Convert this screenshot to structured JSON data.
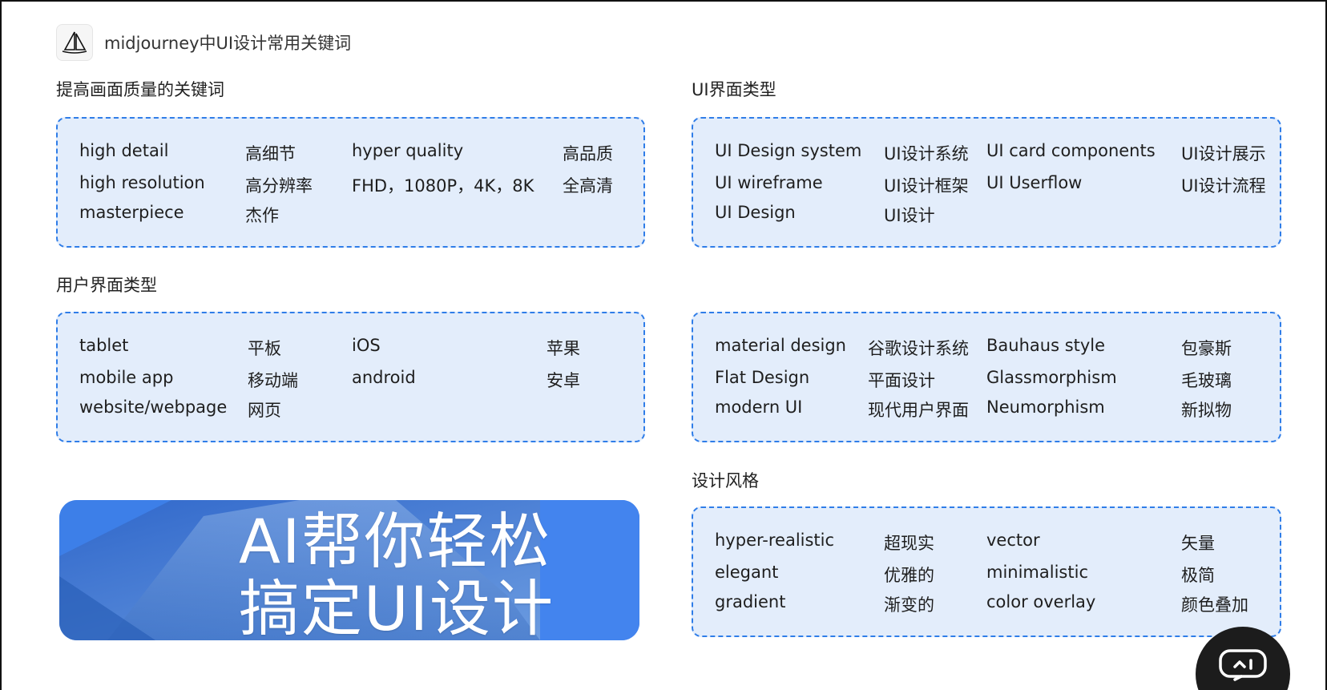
{
  "header": {
    "title": "midjourney中UI设计常用关键词",
    "logo_icon": "sailboat-logo-icon"
  },
  "sections": {
    "quality": {
      "title": "提高画面质量的关键词",
      "rows": [
        [
          "high detail",
          "高细节",
          "hyper quality",
          "高品质"
        ],
        [
          "high resolution",
          "高分辨率",
          "FHD，1080P，4K，8K",
          "全高清"
        ],
        [
          "masterpiece",
          "杰作",
          "",
          ""
        ]
      ]
    },
    "ui_type": {
      "title": "UI界面类型",
      "rows": [
        [
          "UI Design system",
          "UI设计系统",
          "UI card components",
          "UI设计展示"
        ],
        [
          "UI wireframe",
          "UI设计框架",
          "UI Userflow",
          "UI设计流程"
        ],
        [
          "UI Design",
          "UI设计",
          "",
          ""
        ]
      ]
    },
    "user_interface": {
      "title": "用户界面类型",
      "rows": [
        [
          "tablet",
          "平板",
          "iOS",
          "苹果"
        ],
        [
          "mobile app",
          "移动端",
          "android",
          "安卓"
        ],
        [
          "website/webpage",
          "网页",
          "",
          ""
        ]
      ]
    },
    "styles": {
      "title": "",
      "rows": [
        [
          "material design",
          "谷歌设计系统",
          "Bauhaus style",
          "包豪斯"
        ],
        [
          "Flat Design",
          "平面设计",
          "Glassmorphism",
          "毛玻璃"
        ],
        [
          "modern UI",
          "现代用户界面",
          "Neumorphism",
          "新拟物"
        ]
      ]
    },
    "design_style": {
      "title": "设计风格",
      "rows": [
        [
          "hyper-realistic",
          "超现实",
          "vector",
          "矢量"
        ],
        [
          "elegant",
          "优雅的",
          "minimalistic",
          "极简"
        ],
        [
          "gradient",
          "渐变的",
          "color overlay",
          "颜色叠加"
        ]
      ]
    }
  },
  "banner": {
    "line1": "AI帮你轻松",
    "line2": "搞定UI设计"
  },
  "chat_button": {
    "icon": "chat-bubble-icon"
  },
  "colors": {
    "box_bg": "#e3edfb",
    "box_border": "#2f7de8",
    "banner_blue": "#3f7fe6"
  }
}
